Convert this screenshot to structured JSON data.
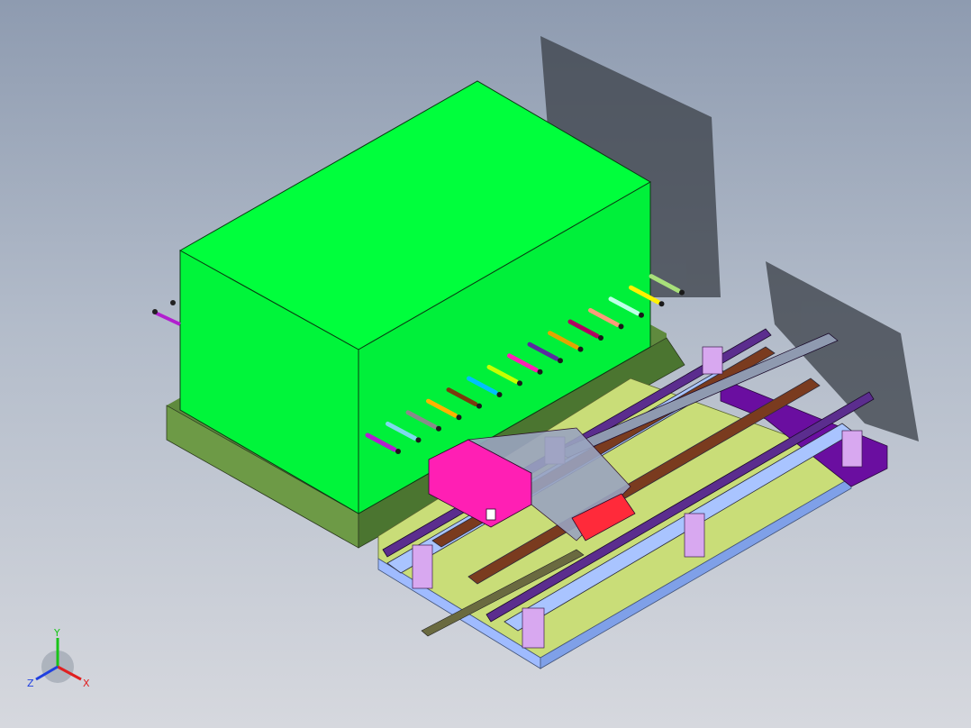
{
  "view": {
    "background_top": "#8e9bb0",
    "background_bottom": "#d6d8de"
  },
  "model": {
    "enclosure_color": "#00ff3c",
    "enclosure_shadow_color": "#3a3f47",
    "base_plate_color": "#5f8a3e",
    "floor_plate_color": "#c9dd78",
    "frame_color": "#a9c4ff",
    "rail_color": "#5b2d8e",
    "beam_color": "#7a3b1f",
    "carriage_color": "#ff1fb4",
    "motor_box_color": "#ff2a3a",
    "pipes": [
      {
        "color": "#b21fcf"
      },
      {
        "color": "#7fd8ee"
      },
      {
        "color": "#8a8a8a"
      },
      {
        "color": "#ffb200"
      },
      {
        "color": "#7a3a0e"
      },
      {
        "color": "#00bfff"
      },
      {
        "color": "#c6ff00"
      },
      {
        "color": "#ff1fb4"
      },
      {
        "color": "#5b2aa0"
      },
      {
        "color": "#e2a400"
      },
      {
        "color": "#b00060"
      },
      {
        "color": "#ff9a7a"
      },
      {
        "color": "#bfffe9"
      },
      {
        "color": "#fff200"
      },
      {
        "color": "#a8e07a"
      }
    ]
  },
  "triad": {
    "y_label": "Y",
    "x_label": "X",
    "z_label": "Z",
    "y_color": "#18c418",
    "x_color": "#e02020",
    "z_color": "#2040e0"
  }
}
